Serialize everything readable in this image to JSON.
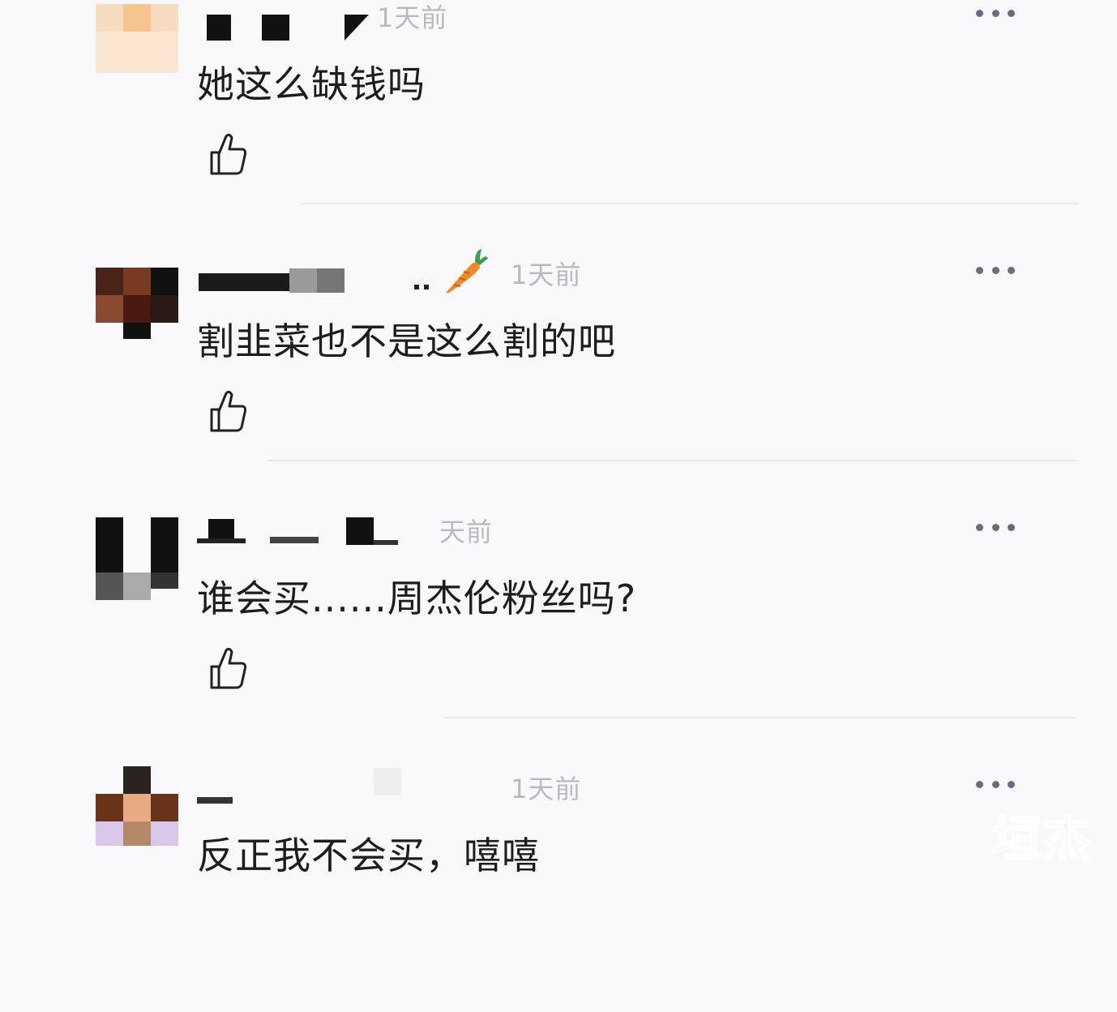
{
  "comments": [
    {
      "time": "1天前",
      "text": "她这么缺钱吗"
    },
    {
      "time": "1天前",
      "text": "割韭菜也不是这么割的吧",
      "name_emoji": "carrot"
    },
    {
      "time": "天前",
      "text": "谁会买......周杰伦粉丝吗?"
    },
    {
      "time": "1天前",
      "text": "反正我不会买，嘻嘻"
    }
  ],
  "watermark": "垣杰",
  "icons": {
    "like": "thumbs-up-icon",
    "more": "more-dots-icon",
    "emoji": "carrot-icon"
  },
  "colors": {
    "background": "#f9f9fb",
    "text": "#1d1d1f",
    "time": "#b9b9c1",
    "divider": "#e7e7ec",
    "more_dots": "#6a6a80"
  }
}
